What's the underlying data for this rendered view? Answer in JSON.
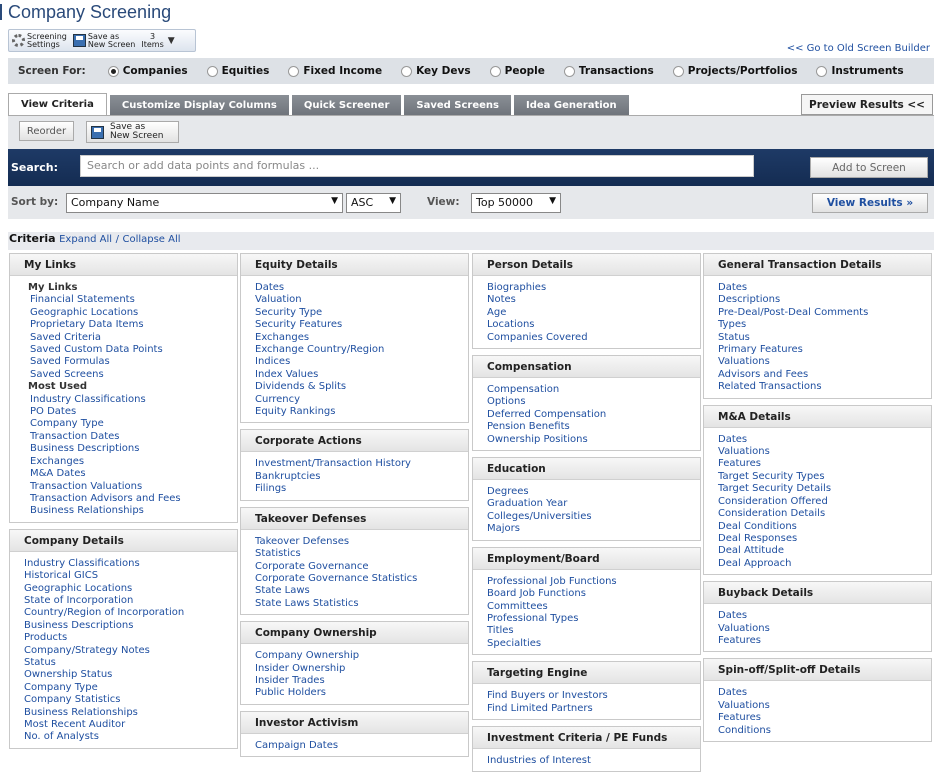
{
  "title": "Company Screening",
  "toolbar": {
    "settings_l1": "Screening",
    "settings_l2": "Settings",
    "saveas_l1": "Save as",
    "saveas_l2": "New Screen",
    "items_count": "3",
    "items_label": "Items"
  },
  "old_link": "<< Go to Old Screen Builder",
  "screen_for": {
    "label": "Screen For:",
    "options": [
      "Companies",
      "Equities",
      "Fixed Income",
      "Key Devs",
      "People",
      "Transactions",
      "Projects/Portfolios",
      "Instruments"
    ],
    "selected": "Companies"
  },
  "tabs": [
    "View Criteria",
    "Customize Display Columns",
    "Quick Screener",
    "Saved Screens",
    "Idea Generation"
  ],
  "preview": "Preview Results <<",
  "reorder": "Reorder",
  "saveas2_l1": "Save as",
  "saveas2_l2": "New Screen",
  "search": {
    "label": "Search:",
    "placeholder": "Search or add data points and formulas ...",
    "add": "Add to Screen"
  },
  "sort": {
    "label": "Sort by:",
    "field": "Company Name",
    "order": "ASC",
    "view_label": "View:",
    "view": "Top 50000",
    "view_results": "View Results »"
  },
  "criteria": {
    "label": "Criteria",
    "expand": "Expand All",
    "sep": "/",
    "collapse": "Collapse All"
  },
  "columns": [
    [
      {
        "title": "My Links",
        "groups": [
          {
            "sub": "My Links",
            "items": [
              "Financial Statements",
              "Geographic Locations",
              "Proprietary Data Items",
              "Saved Criteria",
              "Saved Custom Data Points",
              "Saved Formulas",
              "Saved Screens"
            ]
          },
          {
            "sub": "Most Used",
            "items": [
              "Industry Classifications",
              "PO Dates",
              "Company Type",
              "Transaction Dates",
              "Business Descriptions",
              "Exchanges",
              "M&A Dates",
              "Transaction Valuations",
              "Transaction Advisors and Fees",
              "Business Relationships"
            ]
          }
        ]
      },
      {
        "title": "Company Details",
        "groups": [
          {
            "items": [
              "Industry Classifications",
              "Historical GICS",
              "Geographic Locations",
              "State of Incorporation",
              "Country/Region of Incorporation",
              "Business Descriptions",
              "Products",
              "Company/Strategy Notes",
              "Status",
              "Ownership Status",
              "Company Type",
              "Company Statistics",
              "Business Relationships",
              "Most Recent Auditor",
              "No. of Analysts"
            ]
          }
        ]
      }
    ],
    [
      {
        "title": "Equity Details",
        "groups": [
          {
            "items": [
              "Dates",
              "Valuation",
              "Security Type",
              "Security Features",
              "Exchanges",
              "Exchange Country/Region",
              "Indices",
              "Index Values",
              "Dividends & Splits",
              "Currency",
              "Equity Rankings"
            ]
          }
        ]
      },
      {
        "title": "Corporate Actions",
        "groups": [
          {
            "items": [
              "Investment/Transaction History",
              "Bankruptcies",
              "Filings"
            ]
          }
        ]
      },
      {
        "title": "Takeover Defenses",
        "groups": [
          {
            "items": [
              "Takeover Defenses",
              "Statistics",
              "Corporate Governance",
              "Corporate Governance Statistics",
              "State Laws",
              "State Laws Statistics"
            ]
          }
        ]
      },
      {
        "title": "Company Ownership",
        "groups": [
          {
            "items": [
              "Company Ownership",
              "Insider Ownership",
              "Insider Trades",
              "Public Holders"
            ]
          }
        ]
      },
      {
        "title": "Investor Activism",
        "groups": [
          {
            "items": [
              "Campaign Dates"
            ]
          }
        ]
      }
    ],
    [
      {
        "title": "Person Details",
        "groups": [
          {
            "items": [
              "Biographies",
              "Notes",
              "Age",
              "Locations",
              "Companies Covered"
            ]
          }
        ]
      },
      {
        "title": "Compensation",
        "groups": [
          {
            "items": [
              "Compensation",
              "Options",
              "Deferred Compensation",
              "Pension Benefits",
              "Ownership Positions"
            ]
          }
        ]
      },
      {
        "title": "Education",
        "groups": [
          {
            "items": [
              "Degrees",
              "Graduation Year",
              "Colleges/Universities",
              "Majors"
            ]
          }
        ]
      },
      {
        "title": "Employment/Board",
        "groups": [
          {
            "items": [
              "Professional Job Functions",
              "Board Job Functions",
              "Committees",
              "Professional Types",
              "Titles",
              "Specialties"
            ]
          }
        ]
      },
      {
        "title": "Targeting Engine",
        "groups": [
          {
            "items": [
              "Find Buyers or Investors",
              "Find Limited Partners"
            ]
          }
        ]
      },
      {
        "title": "Investment Criteria / PE Funds",
        "groups": [
          {
            "items": [
              "Industries of Interest"
            ]
          }
        ]
      }
    ],
    [
      {
        "title": "General Transaction Details",
        "groups": [
          {
            "items": [
              "Dates",
              "Descriptions",
              "Pre-Deal/Post-Deal Comments",
              "Types",
              "Status",
              "Primary Features",
              "Valuations",
              "Advisors and Fees",
              "Related Transactions"
            ]
          }
        ]
      },
      {
        "title": "M&A Details",
        "groups": [
          {
            "items": [
              "Dates",
              "Valuations",
              "Features",
              "Target Security Types",
              "Target Security Details",
              "Consideration Offered",
              "Consideration Details",
              "Deal Conditions",
              "Deal Responses",
              "Deal Attitude",
              "Deal Approach"
            ]
          }
        ]
      },
      {
        "title": "Buyback Details",
        "groups": [
          {
            "items": [
              "Dates",
              "Valuations",
              "Features"
            ]
          }
        ]
      },
      {
        "title": "Spin-off/Split-off Details",
        "groups": [
          {
            "items": [
              "Dates",
              "Valuations",
              "Features",
              "Conditions"
            ]
          }
        ]
      }
    ]
  ]
}
